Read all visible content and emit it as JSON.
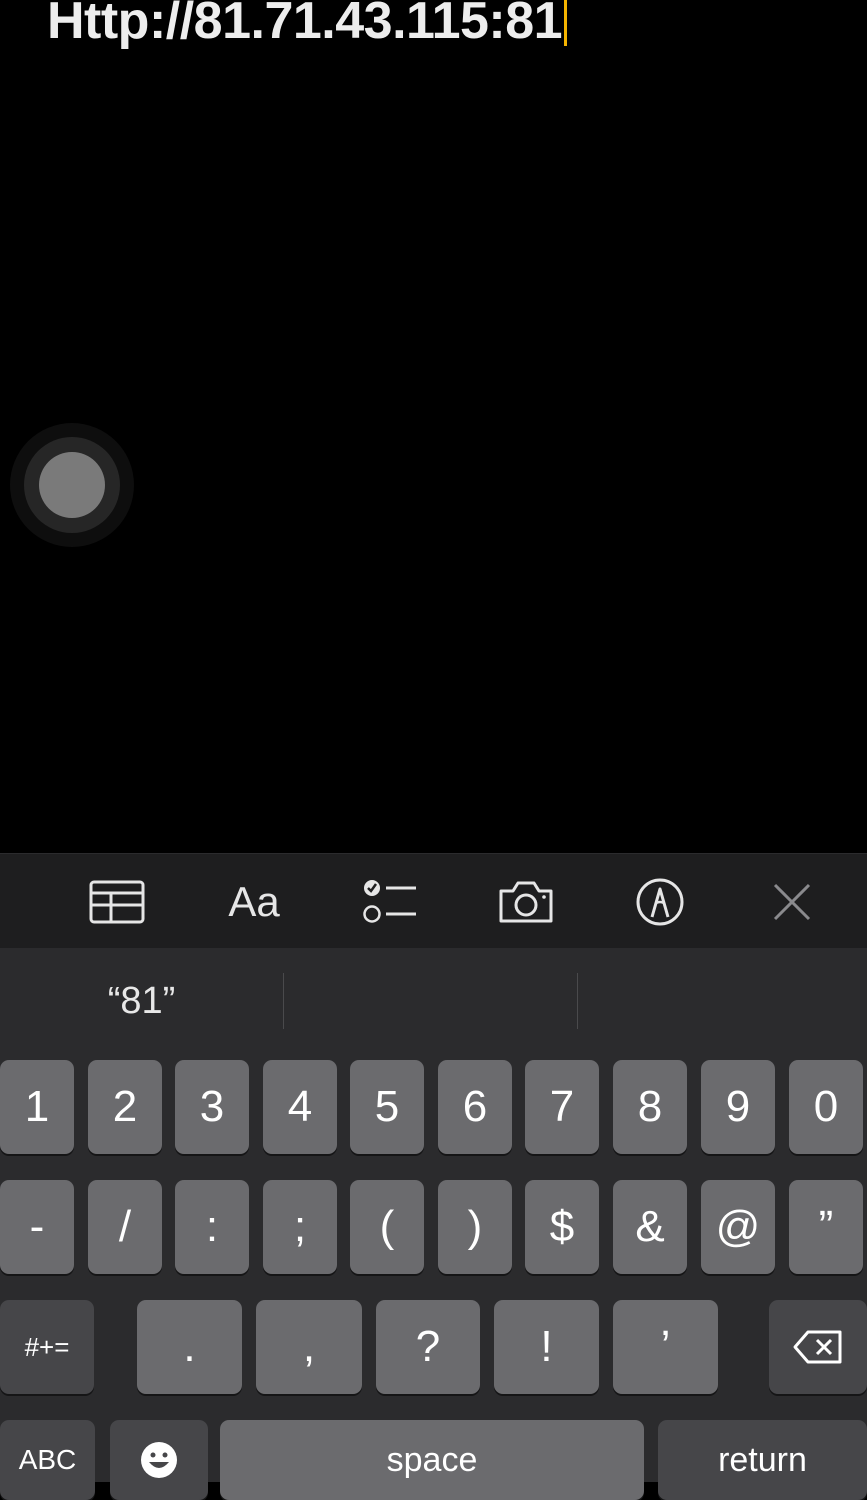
{
  "note": {
    "text": "Http://81.71.43.115:81"
  },
  "toolbar": {
    "items": [
      {
        "name": "table-icon"
      },
      {
        "name": "format-text",
        "label": "Aa"
      },
      {
        "name": "checklist-icon"
      },
      {
        "name": "camera-icon"
      },
      {
        "name": "markup-pen-icon"
      },
      {
        "name": "close-icon"
      }
    ]
  },
  "keyboard": {
    "predictions": [
      "“81”",
      "",
      ""
    ],
    "row1": [
      "1",
      "2",
      "3",
      "4",
      "5",
      "6",
      "7",
      "8",
      "9",
      "0"
    ],
    "row2": [
      "-",
      "/",
      ":",
      ";",
      "(",
      ")",
      "$",
      "&",
      "@",
      "”"
    ],
    "row3": {
      "toggle": "#+=",
      "keys": [
        ".",
        ",",
        "?",
        "!",
        "’"
      ],
      "delete": "delete-icon"
    },
    "row4": {
      "abc": "ABC",
      "emoji": "emoji-icon",
      "space": "space",
      "return": "return"
    }
  },
  "colors": {
    "caret": "#f5b400",
    "key": "#6b6b6e",
    "key_dark": "#464649",
    "keyboard_bg": "#2b2b2d"
  }
}
